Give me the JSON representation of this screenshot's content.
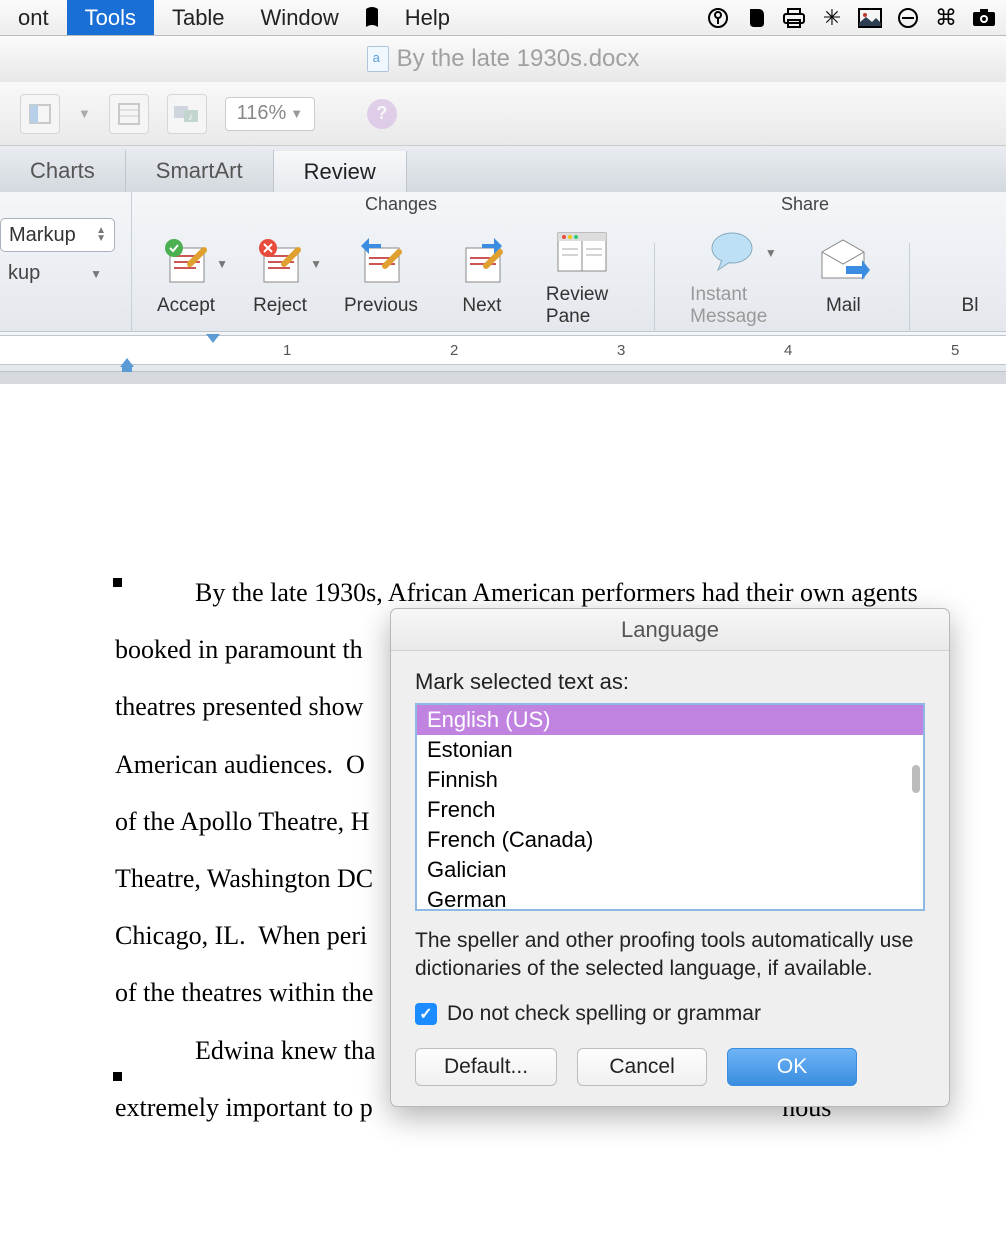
{
  "menubar": {
    "items": [
      "ont",
      "Tools",
      "Table",
      "Window",
      "Help"
    ],
    "active_index": 1
  },
  "status_icons": [
    "script",
    "key-circle",
    "evernote",
    "printer",
    "sparkle",
    "picture",
    "no-entry",
    "command",
    "camera"
  ],
  "document_title": "By the late 1930s.docx",
  "quick_toolbar": {
    "zoom": "116%"
  },
  "tabs": [
    "Charts",
    "SmartArt",
    "Review"
  ],
  "active_tab": 2,
  "ribbon": {
    "group_changes_label": "Changes",
    "group_share_label": "Share",
    "markup_value": "Markup",
    "kup_value": "kup",
    "buttons": {
      "accept": "Accept",
      "reject": "Reject",
      "previous": "Previous",
      "next": "Next",
      "review_pane": "Review Pane",
      "instant_message": "Instant Message",
      "mail": "Mail",
      "blog": "Bl"
    }
  },
  "ruler_numbers": [
    "1",
    "2",
    "3",
    "4",
    "5"
  ],
  "document_lines": [
    "By the late 1930s, African American performers had their own agents",
    "booked in paramount th                                                                     ese",
    "theatres presented show                                                                    antly",
    "American audiences.  O                                                                   Vorld",
    "of the Apollo Theatre, H                                                                    How",
    "Theatre, Washington DC                                                                   The",
    "Chicago, IL.  When peri                                                                     olaye",
    "of the theatres within the",
    "Edwina knew tha                                                                    ness",
    "extremely important to p                                                               nous"
  ],
  "dialog": {
    "title": "Language",
    "mark_label": "Mark selected text as:",
    "languages": [
      "English (US)",
      "Estonian",
      "Finnish",
      "French",
      "French (Canada)",
      "Galician",
      "German"
    ],
    "selected_index": 0,
    "info": "The speller and other proofing tools automatically use dictionaries of the selected language, if available.",
    "checkbox_label": "Do not check spelling or grammar",
    "checkbox_checked": true,
    "buttons": {
      "default": "Default...",
      "cancel": "Cancel",
      "ok": "OK"
    }
  }
}
